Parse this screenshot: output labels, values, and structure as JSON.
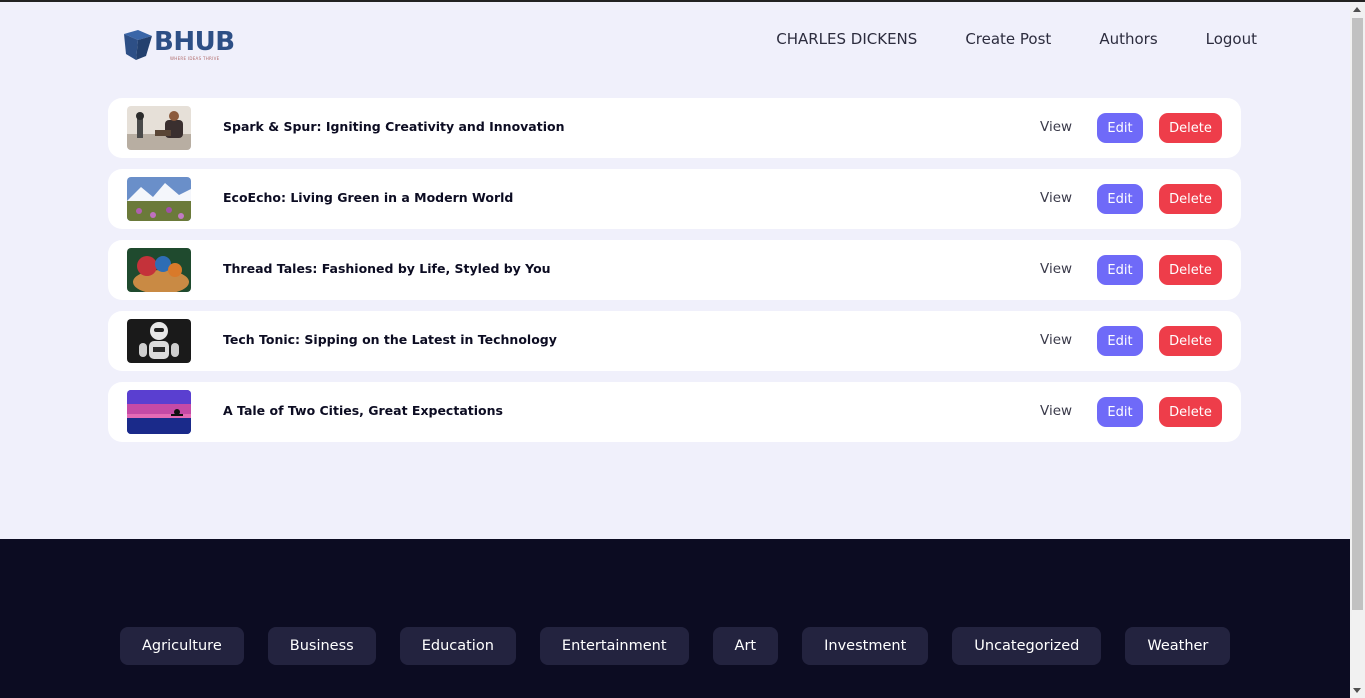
{
  "brand": {
    "name": "BHUB",
    "tagline": "WHERE IDEAS THRIVE",
    "color": "#2d4f86"
  },
  "nav": {
    "links": [
      "CHARLES DICKENS",
      "Create Post",
      "Authors",
      "Logout"
    ]
  },
  "posts": [
    {
      "title": "Spark & Spur: Igniting Creativity and Innovation",
      "thumbnail": "person-with-camera-photo",
      "view": "View",
      "edit": "Edit",
      "delete": "Delete"
    },
    {
      "title": "EcoEcho: Living Green in a Modern World",
      "thumbnail": "mountain-flower-field-photo",
      "view": "View",
      "edit": "Edit",
      "delete": "Delete"
    },
    {
      "title": "Thread Tales: Fashioned by Life, Styled by You",
      "thumbnail": "knitted-basket-photo",
      "view": "View",
      "edit": "Edit",
      "delete": "Delete"
    },
    {
      "title": "Tech Tonic: Sipping on the Latest in Technology",
      "thumbnail": "robot-photo",
      "view": "View",
      "edit": "Edit",
      "delete": "Delete"
    },
    {
      "title": "A Tale of Two Cities, Great Expectations",
      "thumbnail": "sunset-cyclist-photo",
      "view": "View",
      "edit": "Edit",
      "delete": "Delete"
    }
  ],
  "footer": {
    "categories": [
      "Agriculture",
      "Business",
      "Education",
      "Entertainment",
      "Art",
      "Investment",
      "Uncategorized",
      "Weather"
    ]
  },
  "colors": {
    "page_bg": "#f0f0fb",
    "edit_button": "#6f6af8",
    "delete_button": "#ee3d4a",
    "footer_bg": "#0c0c22",
    "category_bg": "#23233f"
  }
}
